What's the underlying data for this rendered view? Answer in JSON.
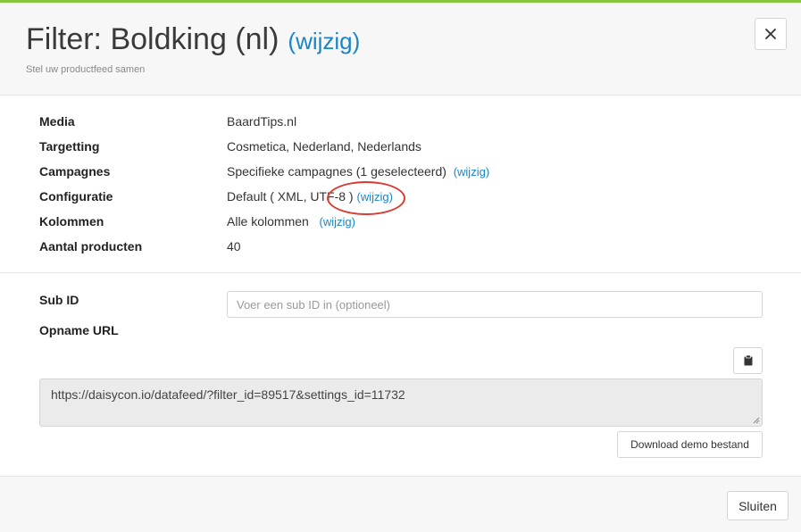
{
  "header": {
    "title": "Filter: Boldking (nl)",
    "title_link": "(wijzig)",
    "subtitle": "Stel uw productfeed samen",
    "close_icon": "close-icon"
  },
  "info": {
    "rows": [
      {
        "label": "Media",
        "value": "BaardTips.nl",
        "link": ""
      },
      {
        "label": "Targetting",
        "value": "Cosmetica, Nederland, Nederlands",
        "link": ""
      },
      {
        "label": "Campagnes",
        "value": "Specifieke campagnes (1 geselecteerd)",
        "link": "(wijzig)"
      },
      {
        "label": "Configuratie",
        "value": "Default ( XML, UTF-8 )",
        "link": "(wijzig)"
      },
      {
        "label": "Kolommen",
        "value": "Alle kolommen",
        "link": "(wijzig)"
      },
      {
        "label": "Aantal producten",
        "value": "40",
        "link": ""
      }
    ]
  },
  "form": {
    "sub_id_label": "Sub ID",
    "sub_id_placeholder": "Voer een sub ID in (optioneel)",
    "opname_url_label": "Opname URL",
    "clipboard_icon": "clipboard-icon",
    "url_value": "https://daisycon.io/datafeed/?filter_id=89517&settings_id=11732",
    "download_label": "Download demo bestand"
  },
  "footer": {
    "close_label": "Sluiten"
  },
  "colors": {
    "accent": "#1a86c8",
    "topbar": "#8cc63f",
    "annotation": "#d93b32"
  }
}
